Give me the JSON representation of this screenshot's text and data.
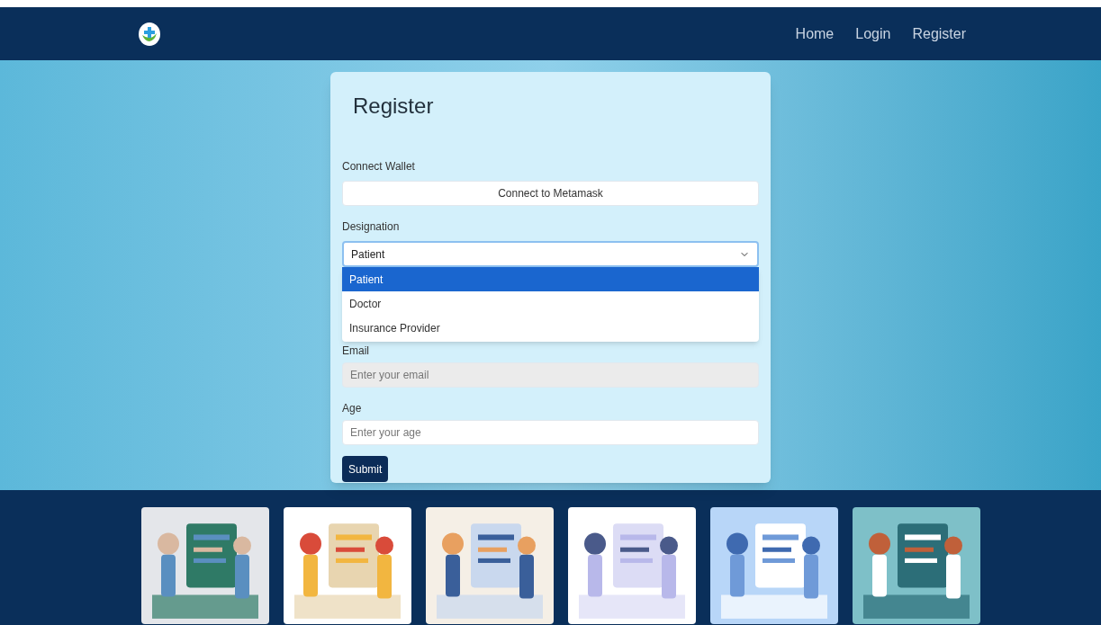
{
  "navbar": {
    "links": [
      {
        "label": "Home"
      },
      {
        "label": "Login"
      },
      {
        "label": "Register"
      }
    ]
  },
  "form": {
    "title": "Register",
    "wallet": {
      "label": "Connect Wallet",
      "button": "Connect to Metamask"
    },
    "designation": {
      "label": "Designation",
      "value": "Patient",
      "expanded": true,
      "options": [
        {
          "label": "Patient",
          "selected": true
        },
        {
          "label": "Doctor",
          "selected": false
        },
        {
          "label": "Insurance Provider",
          "selected": false
        }
      ]
    },
    "fields": [
      {
        "label": "Email",
        "placeholder": "Enter your email",
        "disabled": true
      },
      {
        "label": "Age",
        "placeholder": "Enter your age",
        "disabled": false
      }
    ],
    "submit": "Submit"
  }
}
